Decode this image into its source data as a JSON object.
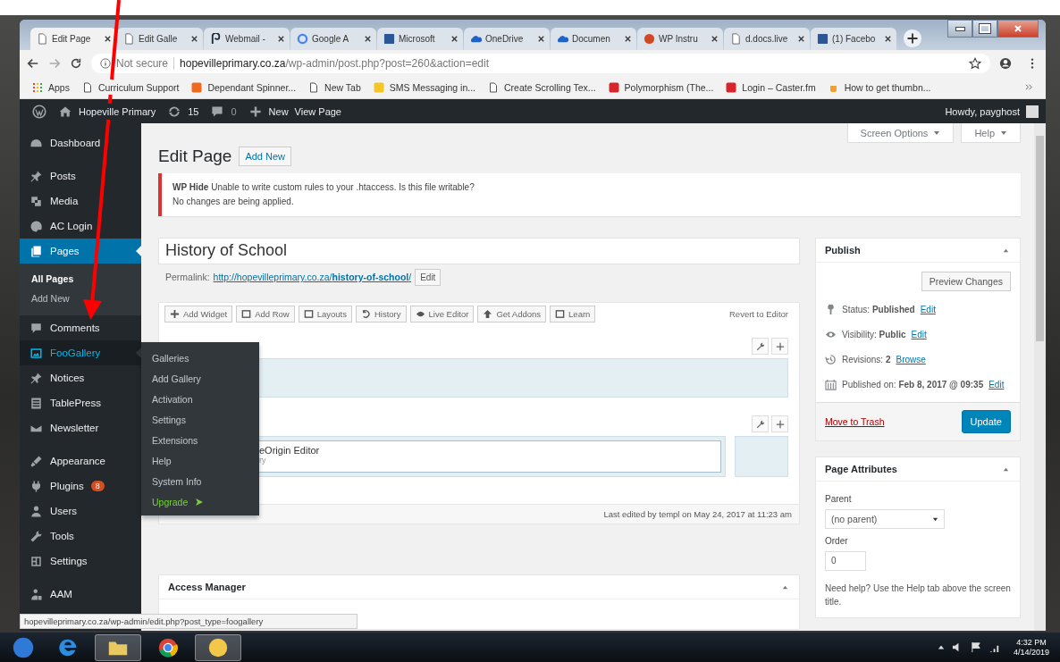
{
  "browser": {
    "tabs": [
      {
        "label": "Edit Page",
        "selected": true
      },
      {
        "label": "Edit Galle",
        "selected": false
      },
      {
        "label": "Webmail -",
        "selected": false
      },
      {
        "label": "Google A",
        "selected": false
      },
      {
        "label": "Microsoft",
        "selected": false
      },
      {
        "label": "OneDrive",
        "selected": false
      },
      {
        "label": "Documen",
        "selected": false
      },
      {
        "label": "WP Instru",
        "selected": false
      },
      {
        "label": "d.docs.live",
        "selected": false
      },
      {
        "label": "(1) Facebo",
        "selected": false
      }
    ],
    "address": {
      "security": "Not secure",
      "host": "hopevilleprimary.co.za",
      "path": "/wp-admin/post.php?post=260&action=edit"
    },
    "bookmarks": [
      "Apps",
      "Curriculum Support",
      "Dependant Spinner...",
      "New Tab",
      "SMS Messaging in...",
      "Create Scrolling Tex...",
      "Polymorphism (The...",
      "Login – Caster.fm",
      "How to get thumbn..."
    ]
  },
  "admin_bar": {
    "site": "Hopeville Primary",
    "updates": "15",
    "comments": "0",
    "new": "New",
    "view": "View Page",
    "howdy": "Howdy, payghost"
  },
  "sidebar": {
    "groups": [
      {
        "items": [
          {
            "label": "Dashboard",
            "selected": false,
            "hovered": false
          }
        ]
      },
      {
        "items": [
          {
            "label": "Posts",
            "selected": false,
            "hovered": false
          },
          {
            "label": "Media",
            "selected": false,
            "hovered": false
          },
          {
            "label": "AC Login",
            "selected": false,
            "hovered": false
          },
          {
            "label": "Pages",
            "selected": true,
            "hovered": false,
            "submenu": [
              {
                "label": "All Pages",
                "selected": true
              },
              {
                "label": "Add New",
                "selected": false
              }
            ]
          },
          {
            "label": "Comments",
            "selected": false,
            "hovered": false
          },
          {
            "label": "FooGallery",
            "selected": false,
            "hovered": true
          },
          {
            "label": "Notices",
            "selected": false,
            "hovered": false
          },
          {
            "label": "TablePress",
            "selected": false,
            "hovered": false
          },
          {
            "label": "Newsletter",
            "selected": false,
            "hovered": false
          }
        ]
      },
      {
        "items": [
          {
            "label": "Appearance",
            "selected": false,
            "hovered": false
          },
          {
            "label": "Plugins",
            "selected": false,
            "hovered": false,
            "badge": "8"
          },
          {
            "label": "Users",
            "selected": false,
            "hovered": false
          },
          {
            "label": "Tools",
            "selected": false,
            "hovered": false
          },
          {
            "label": "Settings",
            "selected": false,
            "hovered": false
          }
        ]
      },
      {
        "items": [
          {
            "label": "AAM",
            "selected": false,
            "hovered": false
          }
        ]
      }
    ]
  },
  "flyout": [
    {
      "label": "Galleries",
      "kind": "link"
    },
    {
      "label": "Add Gallery",
      "kind": "link"
    },
    {
      "label": "Activation",
      "kind": "link"
    },
    {
      "label": "Settings",
      "kind": "link"
    },
    {
      "label": "Extensions",
      "kind": "link"
    },
    {
      "label": "Help",
      "kind": "link"
    },
    {
      "label": "System Info",
      "kind": "link"
    },
    {
      "label": "Upgrade",
      "kind": "upgrade"
    }
  ],
  "screen_meta": [
    "Screen Options",
    "Help"
  ],
  "heading": {
    "title": "Edit Page",
    "action": "Add New"
  },
  "notice": {
    "lines": [
      "**WP Hide** Unable to write custom rules to your .htaccess. Is this file writable?",
      "No changes are being applied."
    ]
  },
  "post_title": "History of School",
  "permalink": {
    "label": "Permalink:",
    "url": "http://hopevilleprimary.co.za/**history-of-school**/",
    "button": "Edit"
  },
  "builder": {
    "toolbar": [
      "Add Widget",
      "Add Row",
      "Layouts",
      "History",
      "Live Editor",
      "Get Addons",
      "Learn"
    ],
    "revert": "Revert to Editor",
    "rows": [
      {
        "cells": [
          {}
        ]
      },
      {
        "cells": [
          {
            "widgets": [
              {
                "title": "eOrigin Editor",
                "subtitle": "ry"
              }
            ]
          },
          {}
        ]
      }
    ]
  },
  "last_edited": "Last edited by templ on May 24, 2017 at 11:23 am",
  "access_manager": {
    "title": "Access Manager"
  },
  "publish": {
    "title": "Publish",
    "preview": "Preview Changes",
    "rows": [
      {
        "text": "Status: **Published**",
        "link": "Edit"
      },
      {
        "text": "Visibility: **Public**",
        "link": "Edit"
      },
      {
        "text": "Revisions: **2**",
        "link": "Browse"
      },
      {
        "text": "Published on: **Feb 8, 2017 @ 09:35**",
        "link": "Edit"
      }
    ],
    "trash": "Move to Trash",
    "update": "Update"
  },
  "page_attributes": {
    "title": "Page Attributes",
    "parent_label": "Parent",
    "parent": "(no parent)",
    "order_label": "Order",
    "order": "0",
    "help": "Need help? Use the Help tab above the screen title."
  },
  "status_url": "hopevilleprimary.co.za/wp-admin/edit.php?post_type=foogallery",
  "taskbar": {
    "apps": [
      {
        "selected": false
      },
      {
        "selected": false
      },
      {
        "selected": true
      },
      {
        "selected": false
      },
      {
        "selected": true
      }
    ],
    "time": "4:32 PM",
    "date": "4/14/2019"
  }
}
